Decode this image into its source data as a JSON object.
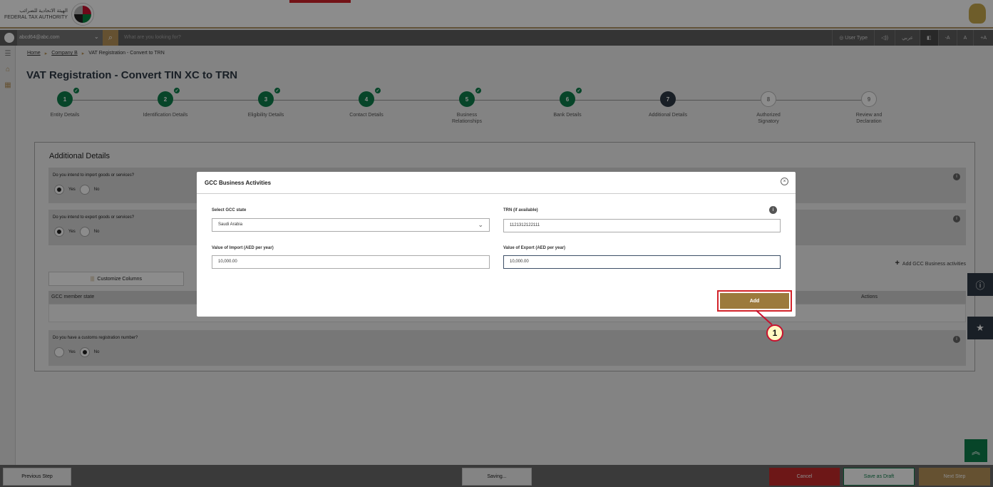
{
  "header": {
    "logo_arabic": "الهيئة الاتحادية للضرائب",
    "logo_english": "FEDERAL TAX AUTHORITY"
  },
  "topnav": {
    "user_email": "abcd64@abc.com",
    "search_placeholder": "What are you looking for?",
    "user_type": "User Type",
    "arabic_toggle": "عربي",
    "font_decrease": "-A",
    "font_normal": "A",
    "font_increase": "+A"
  },
  "breadcrumb": {
    "home": "Home",
    "company": "Company B",
    "current": "VAT Registration - Convert to TRN"
  },
  "page_title": "VAT Registration - Convert TIN XC to TRN",
  "steps": [
    {
      "num": "1",
      "label": "Entity Details",
      "state": "done"
    },
    {
      "num": "2",
      "label": "Identification Details",
      "state": "done"
    },
    {
      "num": "3",
      "label": "Eligibility Details",
      "state": "done"
    },
    {
      "num": "4",
      "label": "Contact Details",
      "state": "done"
    },
    {
      "num": "5",
      "label": "Business Relationships",
      "state": "done"
    },
    {
      "num": "6",
      "label": "Bank Details",
      "state": "done"
    },
    {
      "num": "7",
      "label": "Additional Details",
      "state": "current"
    },
    {
      "num": "8",
      "label": "Authorized Signatory",
      "state": "todo"
    },
    {
      "num": "9",
      "label": "Review and Declaration",
      "state": "todo"
    }
  ],
  "additional": {
    "title": "Additional Details",
    "q_import": "Do you intend to import goods or services?",
    "q_export": "Do you intend to export goods or services?",
    "q_customs": "Do you have a customs registration number?",
    "yes": "Yes",
    "no": "No",
    "add_gcc": "Add GCC Business activities",
    "customize": "Customize Columns",
    "col_state": "GCC member state",
    "col_actions": "Actions"
  },
  "modal": {
    "title": "GCC Business Activities",
    "state_label": "Select GCC state",
    "state_value": "Saudi Arabia",
    "trn_label": "TRN (if available)",
    "trn_value": "1121312122111",
    "import_label": "Value of Import (AED per year)",
    "import_value": "10,000.00",
    "export_label": "Value of Export (AED per year)",
    "export_value": "10,000.00",
    "add_button": "Add"
  },
  "callout_number": "1",
  "footer": {
    "previous": "Previous Step",
    "saving": "Saving...",
    "cancel": "Cancel",
    "save_draft": "Save as Draft",
    "next": "Next Step"
  },
  "colors": {
    "gold": "#b8945a",
    "green": "#0e7f4b",
    "navy": "#2f3a45",
    "red": "#c62a2a"
  }
}
